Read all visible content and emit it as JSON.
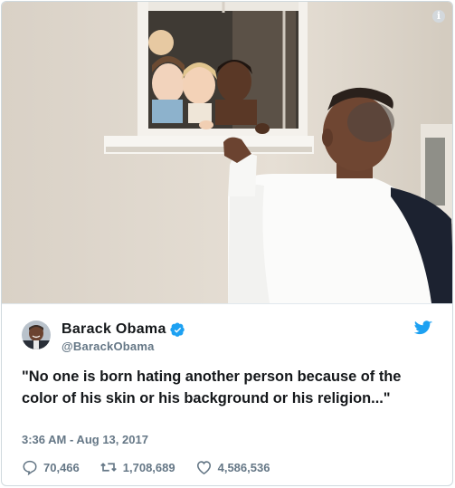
{
  "tweet": {
    "display_name": "Barack Obama",
    "handle": "@BarackObama",
    "text": "\"No one is born hating another person because of the color of his skin or his background or his religion...\"",
    "timestamp": "3:36 AM - Aug 13, 2017",
    "replies": "70,466",
    "retweets": "1,708,689",
    "likes": "4,586,536"
  },
  "icons": {
    "info": "info-icon",
    "verified": "verified-badge-icon",
    "brand": "twitter-bird-icon",
    "reply": "reply-icon",
    "retweet": "retweet-icon",
    "like": "heart-icon"
  },
  "colors": {
    "twitter_blue": "#1da1f2",
    "secondary_text": "#657786",
    "primary_text": "#14171a",
    "border": "#cfd9de"
  }
}
